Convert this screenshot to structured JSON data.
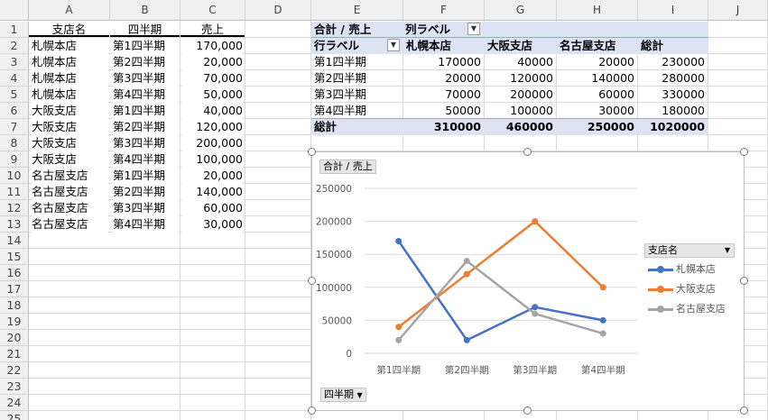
{
  "columns": [
    "A",
    "B",
    "C",
    "D",
    "E",
    "F",
    "G",
    "H",
    "I",
    "J"
  ],
  "rows": [
    "1",
    "2",
    "3",
    "4",
    "5",
    "6",
    "7",
    "8",
    "9",
    "10",
    "11",
    "12",
    "13",
    "14",
    "15",
    "16",
    "17",
    "18",
    "19",
    "20",
    "21",
    "22",
    "23",
    "24",
    "25"
  ],
  "source_table": {
    "headers": [
      "支店名",
      "四半期",
      "売上"
    ],
    "rows": [
      [
        "札幌本店",
        "第1四半期",
        "170,000"
      ],
      [
        "札幌本店",
        "第2四半期",
        "20,000"
      ],
      [
        "札幌本店",
        "第3四半期",
        "70,000"
      ],
      [
        "札幌本店",
        "第4四半期",
        "50,000"
      ],
      [
        "大阪支店",
        "第1四半期",
        "40,000"
      ],
      [
        "大阪支店",
        "第2四半期",
        "120,000"
      ],
      [
        "大阪支店",
        "第3四半期",
        "200,000"
      ],
      [
        "大阪支店",
        "第4四半期",
        "100,000"
      ],
      [
        "名古屋支店",
        "第1四半期",
        "20,000"
      ],
      [
        "名古屋支店",
        "第2四半期",
        "140,000"
      ],
      [
        "名古屋支店",
        "第3四半期",
        "60,000"
      ],
      [
        "名古屋支店",
        "第4四半期",
        "30,000"
      ]
    ]
  },
  "pivot": {
    "value_label": "合計 / 売上",
    "col_label": "列ラベル",
    "row_label": "行ラベル",
    "col_headers": [
      "札幌本店",
      "大阪支店",
      "名古屋支店",
      "総計"
    ],
    "rows": [
      {
        "label": "第1四半期",
        "values": [
          "170000",
          "40000",
          "20000",
          "230000"
        ]
      },
      {
        "label": "第2四半期",
        "values": [
          "20000",
          "120000",
          "140000",
          "280000"
        ]
      },
      {
        "label": "第3四半期",
        "values": [
          "70000",
          "200000",
          "60000",
          "330000"
        ]
      },
      {
        "label": "第4四半期",
        "values": [
          "50000",
          "100000",
          "30000",
          "180000"
        ]
      }
    ],
    "total": {
      "label": "総計",
      "values": [
        "310000",
        "460000",
        "250000",
        "1020000"
      ]
    }
  },
  "chart": {
    "value_button": "合計 / 売上",
    "axis_button": "四半期",
    "legend_button": "支店名"
  },
  "chart_data": {
    "type": "line",
    "categories": [
      "第1四半期",
      "第2四半期",
      "第3四半期",
      "第4四半期"
    ],
    "series": [
      {
        "name": "札幌本店",
        "values": [
          170000,
          20000,
          70000,
          50000
        ],
        "color": "#4472c4"
      },
      {
        "name": "大阪支店",
        "values": [
          40000,
          120000,
          200000,
          100000
        ],
        "color": "#ed7d31"
      },
      {
        "name": "名古屋支店",
        "values": [
          20000,
          140000,
          60000,
          30000
        ],
        "color": "#a5a5a5"
      }
    ],
    "yticks": [
      "0",
      "50000",
      "100000",
      "150000",
      "200000",
      "250000"
    ],
    "ylim": [
      0,
      250000
    ],
    "grid": true,
    "legend": "right"
  }
}
